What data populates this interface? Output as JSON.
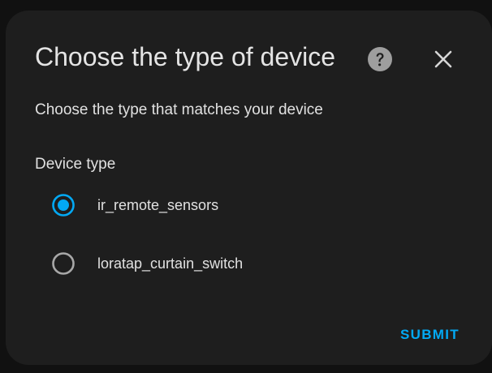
{
  "dialog": {
    "title": "Choose the type of device",
    "help_icon": "help-circle-icon",
    "close_icon": "close-icon",
    "subtitle": "Choose the type that matches your device"
  },
  "field": {
    "label": "Device type",
    "options": [
      {
        "label": "ir_remote_sensors",
        "selected": true
      },
      {
        "label": "loratap_curtain_switch",
        "selected": false
      }
    ]
  },
  "actions": {
    "submit_label": "SUBMIT"
  },
  "colors": {
    "accent": "#03a9f4",
    "surface": "#1e1e1e",
    "background": "#111111",
    "text": "#e1e1e1",
    "icon": "#9e9e9e"
  }
}
